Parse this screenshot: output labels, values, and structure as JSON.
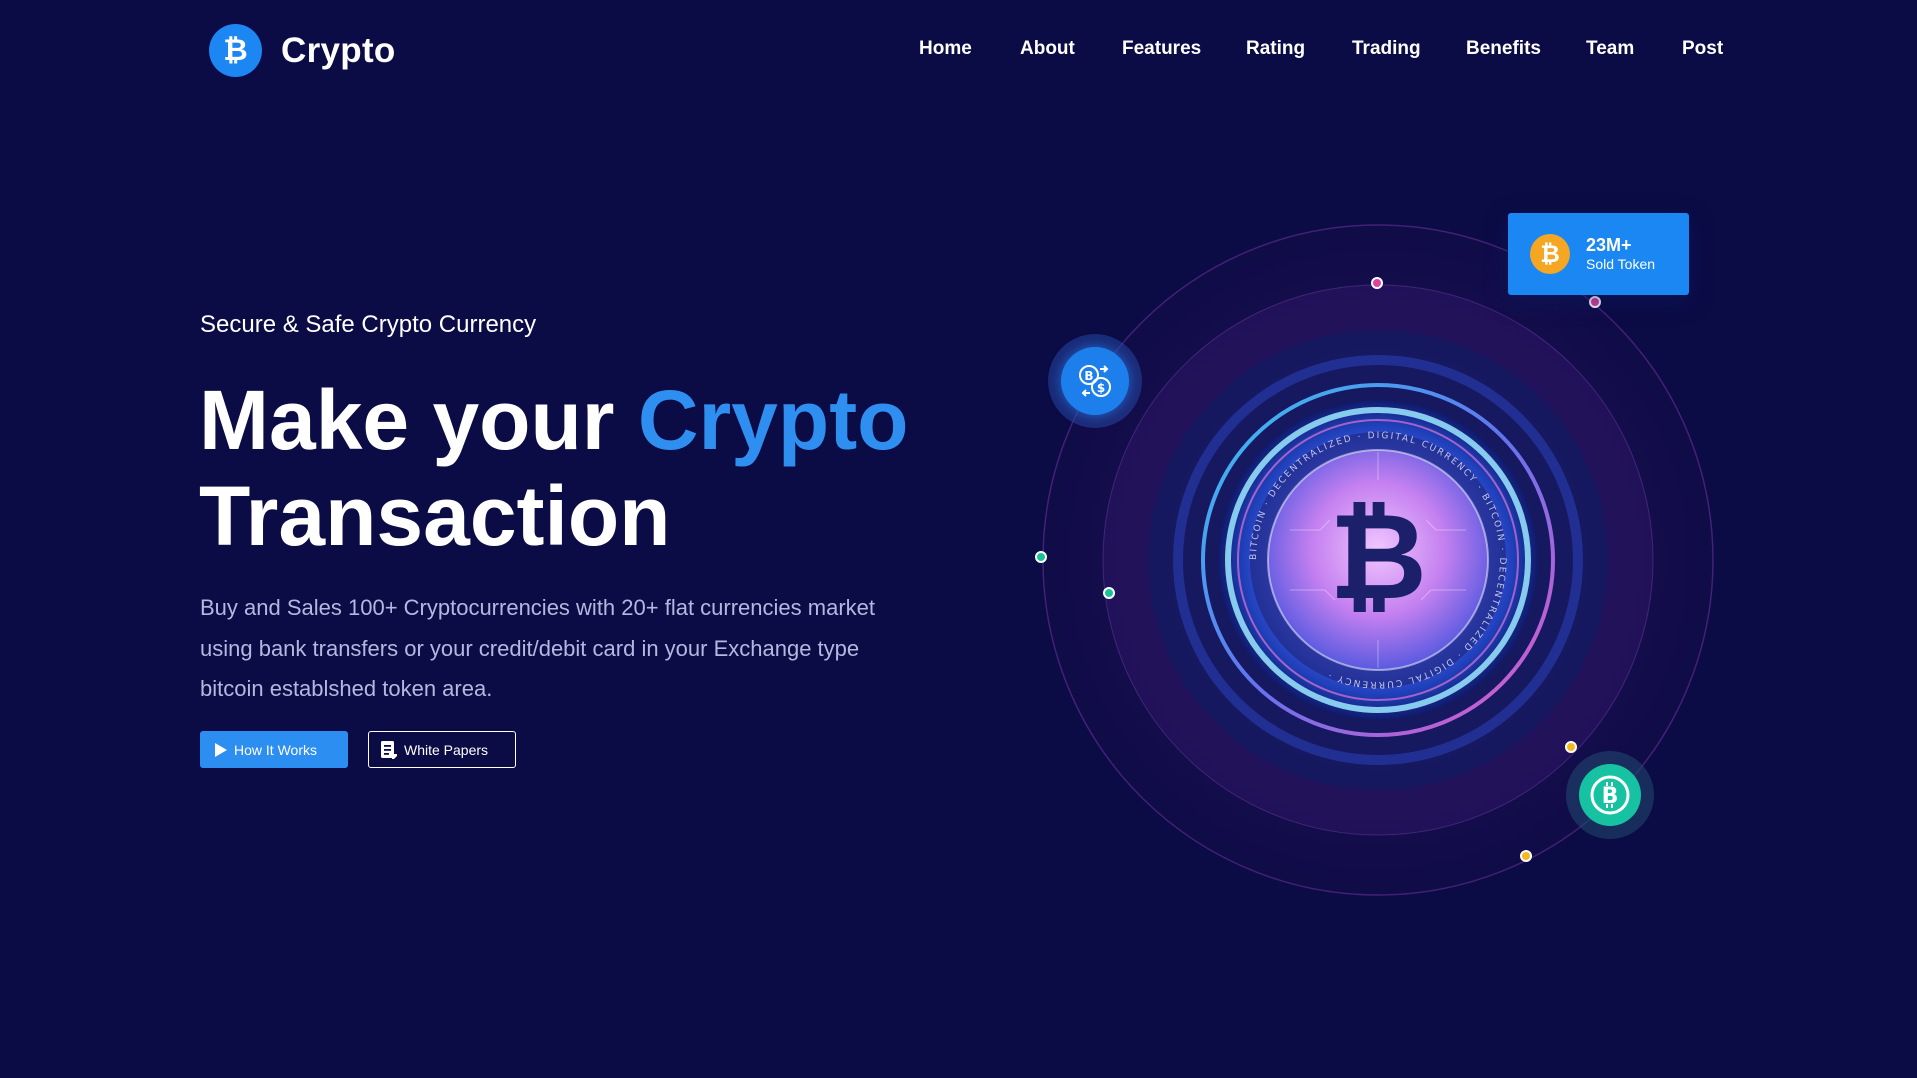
{
  "brand": {
    "name": "Crypto",
    "logo_glyph": "₿",
    "color": "#1c86f2"
  },
  "nav": {
    "items": [
      "Home",
      "About",
      "Features",
      "Rating",
      "Trading",
      "Benefits",
      "Team",
      "Post"
    ]
  },
  "hero": {
    "tagline": "Secure & Safe Crypto Currency",
    "headline_part1": "Make your ",
    "headline_accent": "Crypto",
    "headline_part2": "Transaction",
    "description": "Buy and Sales 100+ Cryptocurrencies with 20+ flat currencies market using bank transfers or your credit/debit card in your Exchange type bitcoin establshed token area.",
    "primary_button": "How It Works",
    "secondary_button": "White Papers"
  },
  "stat_card": {
    "value": "23M+",
    "label": "Sold Token",
    "coin_glyph": "₿"
  },
  "coin": {
    "glyph": "₿",
    "ring_text": "BITCOIN · DECENTRALIZED · DIGITAL CURRENCY · BITCOIN · DECENTRALIZED · DIGITAL CURRENCY ·"
  },
  "icons": {
    "logo": "bitcoin-icon",
    "primary_button": "play-icon",
    "secondary_button": "document-icon",
    "float_left": "currency-exchange-icon",
    "float_right": "bitcoin-icon",
    "stat_card": "bitcoin-coin-icon"
  },
  "colors": {
    "background": "#0b0b45",
    "accent": "#2f8ff0",
    "button": "#2c8ef1",
    "description": "#b4b8e0",
    "coin_gold": "#f5a623",
    "coin_green": "#17c2a2",
    "dot_pink": "#e040a0",
    "dot_green": "#18c29a",
    "dot_yellow": "#f5b820"
  }
}
